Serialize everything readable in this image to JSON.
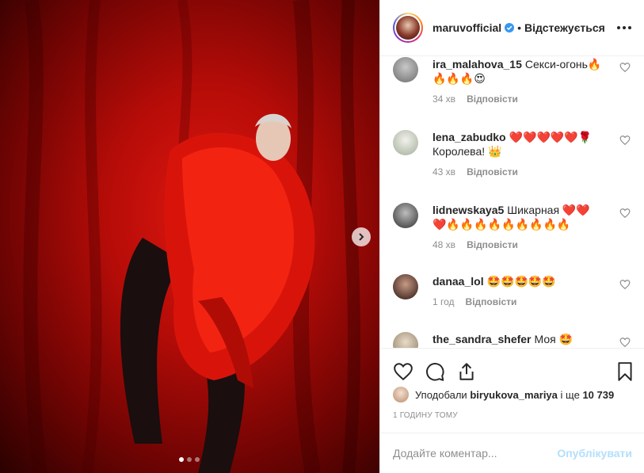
{
  "post": {
    "username": "maruvofficial",
    "separator": "•",
    "follow_status": "Відстежується",
    "carousel_count": 3,
    "carousel_active": 1
  },
  "comments": [
    {
      "user": "ira_malahova_15",
      "text": "Секси-огонь🔥🔥🔥🔥😍",
      "time": "34 хв",
      "reply": "Відповісти",
      "avatar_color": "#6b6b6b"
    },
    {
      "user": "lena_zabudko",
      "text": "❤️❤️❤️❤️❤️🌹 Королева! 👑",
      "time": "43 хв",
      "reply": "Відповісти",
      "avatar_color": "#c9d3c7"
    },
    {
      "user": "lidnewskaya5",
      "text": "Шикарная ❤️❤️❤️🔥🔥🔥🔥🔥🔥🔥🔥🔥",
      "time": "48 хв",
      "reply": "Відповісти",
      "avatar_color": "#3d3d3d"
    },
    {
      "user": "danaa_lol",
      "text": "🤩🤩🤩🤩🤩",
      "time": "1 год",
      "reply": "Відповісти",
      "avatar_color": "#4a2a22"
    },
    {
      "user": "the_sandra_shefer",
      "text": "Моя 🤩",
      "time": "",
      "reply": "",
      "avatar_color": "#b8a88f"
    }
  ],
  "likes": {
    "prefix": "Уподобали",
    "user": "biryukova_mariya",
    "middle": "і ще",
    "count": "10 739"
  },
  "posted_ago": "1 годину тому",
  "comment_box": {
    "placeholder": "Додайте коментар...",
    "publish_label": "Опублікувати"
  },
  "colors": {
    "verified": "#3897f0",
    "publish_disabled": "#b2dffc",
    "muted": "#8e8e8e"
  }
}
